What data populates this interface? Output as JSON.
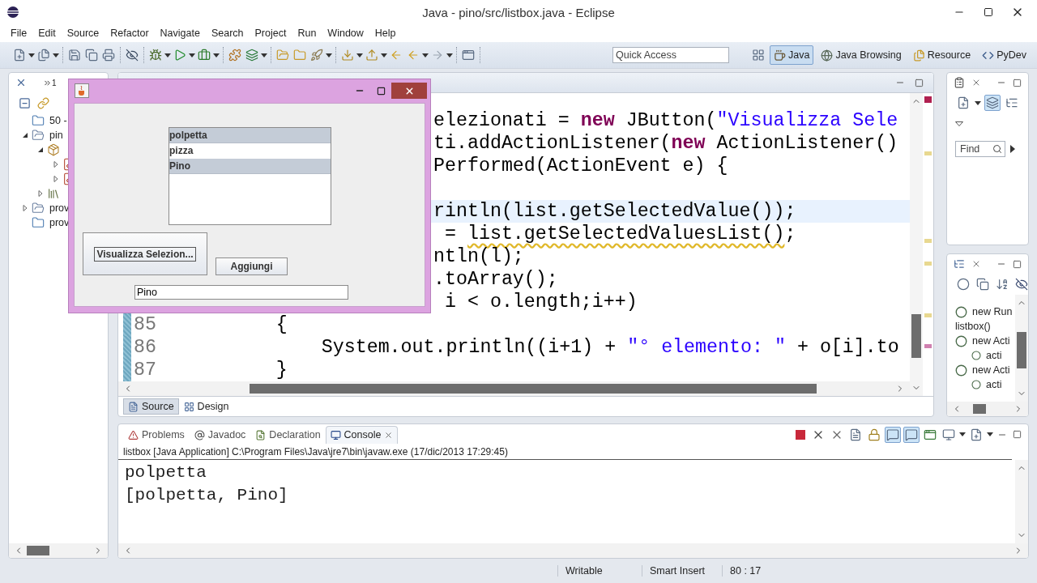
{
  "window": {
    "title": "Java - pino/src/listbox.java - Eclipse"
  },
  "menu": [
    "File",
    "Edit",
    "Source",
    "Refactor",
    "Navigate",
    "Search",
    "Project",
    "Run",
    "Window",
    "Help"
  ],
  "quick_access": {
    "placeholder": "Quick Access"
  },
  "perspectives": [
    {
      "label": "Java",
      "selected": true
    },
    {
      "label": "Java Browsing",
      "selected": false
    },
    {
      "label": "Resource",
      "selected": false
    },
    {
      "label": "PyDev",
      "selected": false
    }
  ],
  "package_explorer": {
    "hidden_views": "1",
    "tree": [
      {
        "label": "50 -",
        "kind": "folder"
      },
      {
        "label": "pin",
        "kind": "project",
        "expanded": true,
        "children": [
          {
            "kind": "source",
            "expanded": true,
            "children": [
              {
                "kind": "file",
                "expanded": false
              },
              {
                "kind": "file",
                "expanded": false
              }
            ]
          },
          {
            "kind": "library",
            "expanded": false
          }
        ]
      },
      {
        "label": "prov",
        "kind": "project",
        "expanded": false
      },
      {
        "label": "prov",
        "kind": "folder"
      }
    ]
  },
  "editor": {
    "lines": [
      {
        "current": false,
        "segments": [
          {
            "kind": "plain",
            "text": "elezionati = "
          },
          {
            "kind": "keyword",
            "text": "new"
          },
          {
            "kind": "plain",
            "text": " JButton("
          },
          {
            "kind": "string",
            "text": "\"Visualizza Sele"
          }
        ]
      },
      {
        "current": false,
        "segments": [
          {
            "kind": "plain",
            "text": "ti.addActionListener("
          },
          {
            "kind": "keyword",
            "text": "new"
          },
          {
            "kind": "plain",
            "text": " ActionListener()"
          }
        ]
      },
      {
        "current": false,
        "segments": [
          {
            "kind": "plain",
            "text": "Performed(ActionEvent e) {"
          }
        ]
      },
      {
        "current": false
      },
      {
        "current": true,
        "segments": [
          {
            "kind": "plain",
            "text": "rintln(list.getSelectedValue());"
          }
        ]
      },
      {
        "current": false,
        "segments": [
          {
            "kind": "plain",
            "text": " = "
          },
          {
            "kind": "warning",
            "text": "list.getSelectedValuesList()"
          },
          {
            "kind": "plain",
            "text": ";"
          }
        ]
      },
      {
        "current": false,
        "segments": [
          {
            "kind": "plain",
            "text": "ntln(l);"
          }
        ]
      },
      {
        "current": false,
        "segments": [
          {
            "kind": "plain",
            "text": ".toArray();"
          }
        ]
      },
      {
        "current": false,
        "segments": [
          {
            "kind": "plain",
            "text": " i < o.length;i++)"
          }
        ]
      },
      {
        "number": "85",
        "current": false,
        "changed": true,
        "segments": [
          {
            "kind": "plain",
            "text": "          {"
          }
        ]
      },
      {
        "number": "86",
        "current": false,
        "changed": true,
        "segments": [
          {
            "kind": "plain",
            "text": "              System.out.println((i+1) + "
          },
          {
            "kind": "string",
            "text": "\"° elemento: \""
          },
          {
            "kind": "plain",
            "text": " + o[i].to"
          }
        ]
      },
      {
        "number": "87",
        "current": false,
        "changed": true,
        "segments": [
          {
            "kind": "plain",
            "text": "          }"
          }
        ]
      }
    ],
    "bottom_tabs": [
      {
        "label": "Source",
        "selected": true
      },
      {
        "label": "Design",
        "selected": false
      }
    ]
  },
  "task_panel": {
    "find": {
      "placeholder": "Find"
    },
    "toggles": [
      {
        "on": true
      },
      {
        "on": false
      }
    ]
  },
  "outline": {
    "items": [
      {
        "label": "new Run"
      },
      {
        "label": "listbox()"
      },
      {
        "label": "new Acti",
        "children": [
          {
            "label": "acti"
          }
        ]
      },
      {
        "label": "new Acti",
        "children": [
          {
            "label": "acti"
          }
        ]
      }
    ]
  },
  "console": {
    "tabs": [
      {
        "label": "Problems",
        "selected": false
      },
      {
        "label": "Javadoc",
        "selected": false
      },
      {
        "label": "Declaration",
        "selected": false
      },
      {
        "label": "Console",
        "selected": true
      }
    ],
    "toggles": [
      {
        "on": true
      },
      {
        "on": true
      }
    ],
    "header": "listbox [Java Application] C:\\Program Files\\Java\\jre7\\bin\\javaw.exe (17/dic/2013 17:29:45)",
    "output": [
      "polpetta",
      "[polpetta, Pino]"
    ]
  },
  "status_bar": {
    "fields": [
      "Writable",
      "Smart Insert",
      "80 : 17"
    ]
  },
  "java_frame": {
    "list": [
      {
        "label": "polpetta",
        "selected": true
      },
      {
        "label": "pizza",
        "selected": false
      },
      {
        "label": "Pino",
        "selected": true
      }
    ],
    "buttons": [
      {
        "label": "Visualizza Selezion...",
        "focused": true
      },
      {
        "label": "Aggiungi",
        "focused": false
      }
    ],
    "field": {
      "value": "Pino"
    }
  }
}
